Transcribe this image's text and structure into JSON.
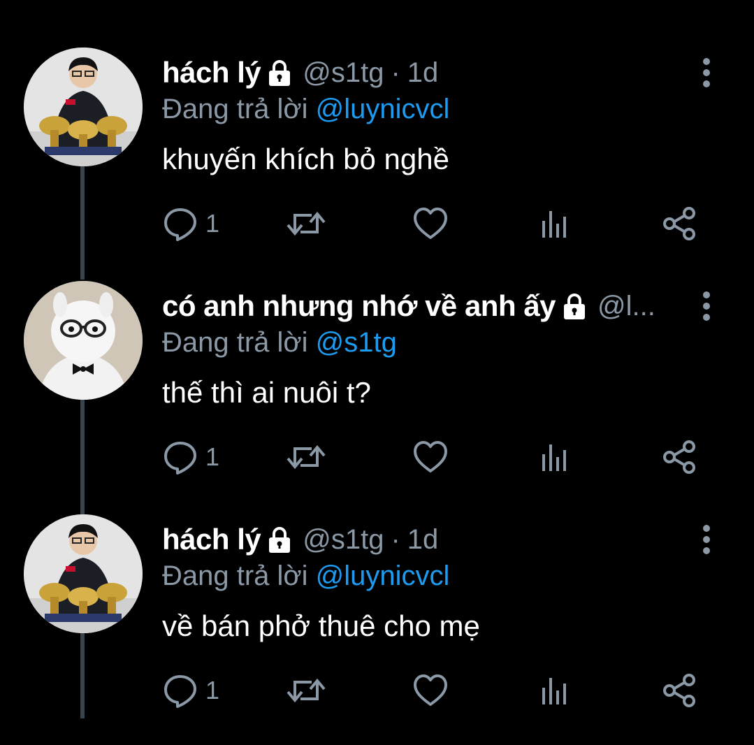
{
  "colors": {
    "background": "#000000",
    "name": "#ffffff",
    "secondary_text": "#8b98a5",
    "mention": "#1d9bf0",
    "thread_line": "#38444d"
  },
  "tweets": [
    {
      "avatar_icon": "person-with-trophies-avatar",
      "name": "hách lý",
      "protected_icon": "lock-icon",
      "handle": "@s1tg",
      "separator": "·",
      "time": "1d",
      "reply_prefix": "Đang trả lời",
      "reply_to": "@luynicvcl",
      "text": "khuyến khích bỏ nghề",
      "reply_count": "1"
    },
    {
      "avatar_icon": "alpaca-plush-avatar",
      "name": "có anh nhưng nhớ về anh ấy",
      "protected_icon": "lock-icon",
      "handle": "@l...",
      "separator": "",
      "time": "",
      "reply_prefix": "Đang trả lời",
      "reply_to": "@s1tg",
      "text": "thế thì ai nuôi t?",
      "reply_count": "1"
    },
    {
      "avatar_icon": "person-with-trophies-avatar",
      "name": "hách lý",
      "protected_icon": "lock-icon",
      "handle": "@s1tg",
      "separator": "·",
      "time": "1d",
      "reply_prefix": "Đang trả lời",
      "reply_to": "@luynicvcl",
      "text": "về bán phở thuê cho mẹ",
      "reply_count": "1"
    }
  ]
}
